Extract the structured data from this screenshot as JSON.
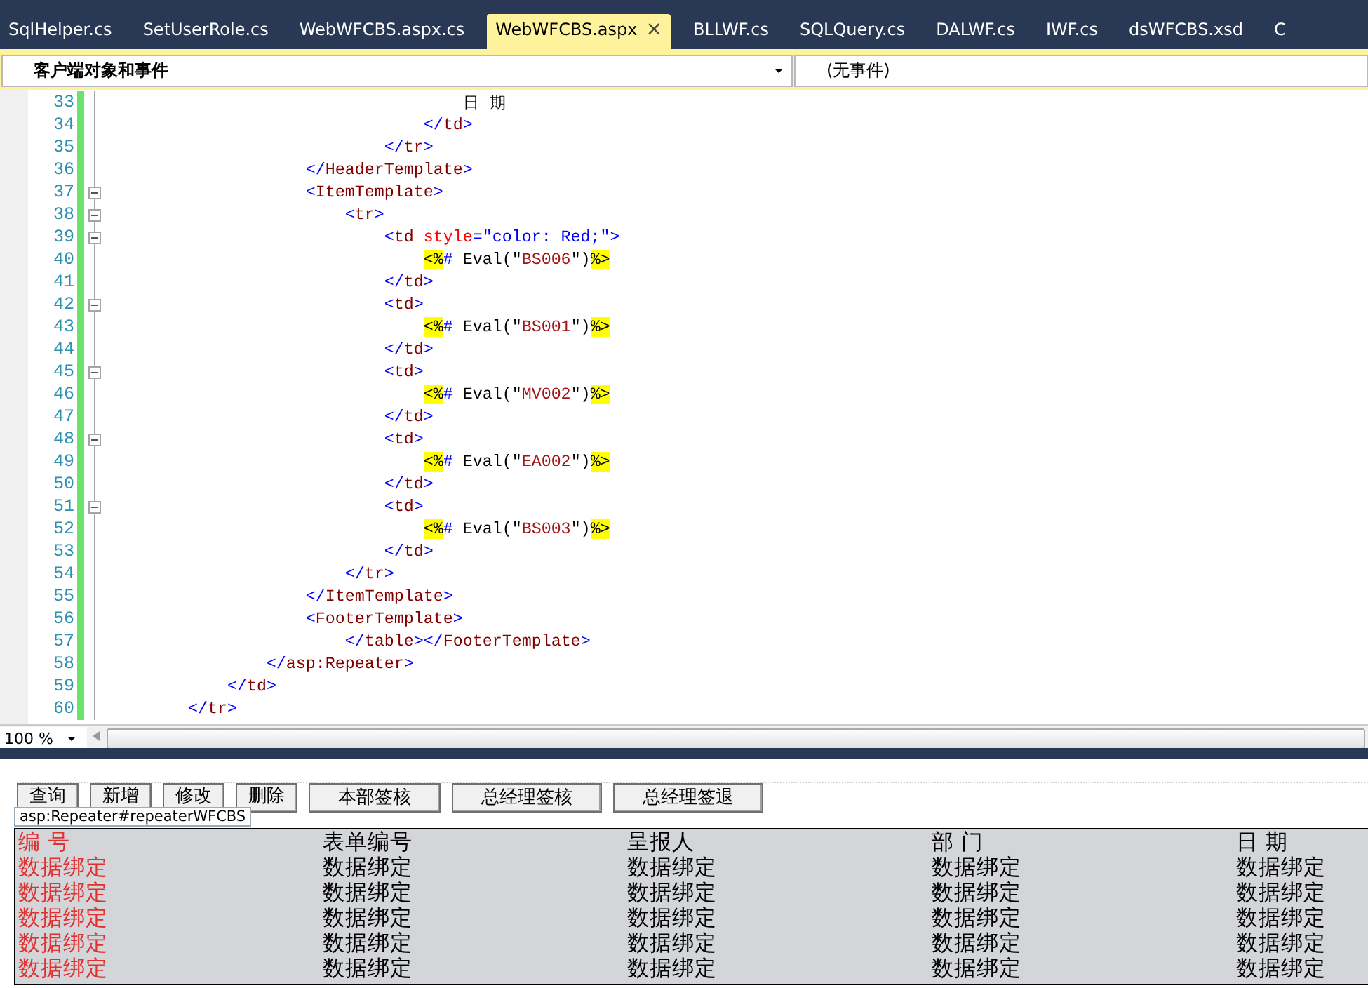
{
  "tabs": [
    {
      "label": "SqlHelper.cs",
      "selected": false
    },
    {
      "label": "SetUserRole.cs",
      "selected": false
    },
    {
      "label": "WebWFCBS.aspx.cs",
      "selected": false
    },
    {
      "label": "WebWFCBS.aspx",
      "selected": true,
      "close": "×"
    },
    {
      "label": "BLLWF.cs",
      "selected": false
    },
    {
      "label": "SQLQuery.cs",
      "selected": false
    },
    {
      "label": "DALWF.cs",
      "selected": false
    },
    {
      "label": "IWF.cs",
      "selected": false
    },
    {
      "label": "dsWFCBS.xsd",
      "selected": false
    },
    {
      "label": "C",
      "selected": false
    }
  ],
  "navigation_bar": {
    "objects": "客户端对象和事件",
    "events": "(无事件)"
  },
  "editor": {
    "lines": [
      {
        "number": "33",
        "collapsible": false,
        "tokens": [
          {
            "kind": "text",
            "text": "                                    日 期"
          }
        ]
      },
      {
        "number": "34",
        "collapsible": false,
        "tokens": [
          {
            "kind": "delimiter",
            "text": "                                </"
          },
          {
            "kind": "tag",
            "text": "td"
          },
          {
            "kind": "delimiter",
            "text": ">"
          }
        ]
      },
      {
        "number": "35",
        "collapsible": false,
        "tokens": [
          {
            "kind": "delimiter",
            "text": "                            </"
          },
          {
            "kind": "tag",
            "text": "tr"
          },
          {
            "kind": "delimiter",
            "text": ">"
          }
        ]
      },
      {
        "number": "36",
        "collapsible": false,
        "tokens": [
          {
            "kind": "delimiter",
            "text": "                    </"
          },
          {
            "kind": "tag",
            "text": "HeaderTemplate"
          },
          {
            "kind": "delimiter",
            "text": ">"
          }
        ]
      },
      {
        "number": "37",
        "collapsible": true,
        "tokens": [
          {
            "kind": "delimiter",
            "text": "                    <"
          },
          {
            "kind": "tag",
            "text": "ItemTemplate"
          },
          {
            "kind": "delimiter",
            "text": ">"
          }
        ]
      },
      {
        "number": "38",
        "collapsible": true,
        "tokens": [
          {
            "kind": "delimiter",
            "text": "                        <"
          },
          {
            "kind": "tag",
            "text": "tr"
          },
          {
            "kind": "delimiter",
            "text": ">"
          }
        ]
      },
      {
        "number": "39",
        "collapsible": true,
        "tokens": [
          {
            "kind": "delimiter",
            "text": "                            <"
          },
          {
            "kind": "tag",
            "text": "td"
          },
          {
            "kind": "attribute",
            "text": " style"
          },
          {
            "kind": "delimiter",
            "text": "=\""
          },
          {
            "kind": "value",
            "text": "color: Red;"
          },
          {
            "kind": "delimiter",
            "text": "\">"
          }
        ]
      },
      {
        "number": "40",
        "collapsible": false,
        "tokens": [
          {
            "kind": "server",
            "text": "                                <%"
          },
          {
            "kind": "hash",
            "text": "#"
          },
          {
            "kind": "text",
            "text": " Eval(\""
          },
          {
            "kind": "string",
            "text": "BS006"
          },
          {
            "kind": "text",
            "text": "\")"
          },
          {
            "kind": "server",
            "text": "%>"
          }
        ]
      },
      {
        "number": "41",
        "collapsible": false,
        "tokens": [
          {
            "kind": "delimiter",
            "text": "                            </"
          },
          {
            "kind": "tag",
            "text": "td"
          },
          {
            "kind": "delimiter",
            "text": ">"
          }
        ]
      },
      {
        "number": "42",
        "collapsible": true,
        "tokens": [
          {
            "kind": "delimiter",
            "text": "                            <"
          },
          {
            "kind": "tag",
            "text": "td"
          },
          {
            "kind": "delimiter",
            "text": ">"
          }
        ]
      },
      {
        "number": "43",
        "collapsible": false,
        "tokens": [
          {
            "kind": "server",
            "text": "                                <%"
          },
          {
            "kind": "hash",
            "text": "#"
          },
          {
            "kind": "text",
            "text": " Eval(\""
          },
          {
            "kind": "string",
            "text": "BS001"
          },
          {
            "kind": "text",
            "text": "\")"
          },
          {
            "kind": "server",
            "text": "%>"
          }
        ]
      },
      {
        "number": "44",
        "collapsible": false,
        "tokens": [
          {
            "kind": "delimiter",
            "text": "                            </"
          },
          {
            "kind": "tag",
            "text": "td"
          },
          {
            "kind": "delimiter",
            "text": ">"
          }
        ]
      },
      {
        "number": "45",
        "collapsible": true,
        "tokens": [
          {
            "kind": "delimiter",
            "text": "                            <"
          },
          {
            "kind": "tag",
            "text": "td"
          },
          {
            "kind": "delimiter",
            "text": ">"
          }
        ]
      },
      {
        "number": "46",
        "collapsible": false,
        "tokens": [
          {
            "kind": "server",
            "text": "                                <%"
          },
          {
            "kind": "hash",
            "text": "#"
          },
          {
            "kind": "text",
            "text": " Eval(\""
          },
          {
            "kind": "string",
            "text": "MV002"
          },
          {
            "kind": "text",
            "text": "\")"
          },
          {
            "kind": "server",
            "text": "%>"
          }
        ]
      },
      {
        "number": "47",
        "collapsible": false,
        "tokens": [
          {
            "kind": "delimiter",
            "text": "                            </"
          },
          {
            "kind": "tag",
            "text": "td"
          },
          {
            "kind": "delimiter",
            "text": ">"
          }
        ]
      },
      {
        "number": "48",
        "collapsible": true,
        "tokens": [
          {
            "kind": "delimiter",
            "text": "                            <"
          },
          {
            "kind": "tag",
            "text": "td"
          },
          {
            "kind": "delimiter",
            "text": ">"
          }
        ]
      },
      {
        "number": "49",
        "collapsible": false,
        "tokens": [
          {
            "kind": "server",
            "text": "                                <%"
          },
          {
            "kind": "hash",
            "text": "#"
          },
          {
            "kind": "text",
            "text": " Eval(\""
          },
          {
            "kind": "string",
            "text": "EA002"
          },
          {
            "kind": "text",
            "text": "\")"
          },
          {
            "kind": "server",
            "text": "%>"
          }
        ]
      },
      {
        "number": "50",
        "collapsible": false,
        "tokens": [
          {
            "kind": "delimiter",
            "text": "                            </"
          },
          {
            "kind": "tag",
            "text": "td"
          },
          {
            "kind": "delimiter",
            "text": ">"
          }
        ]
      },
      {
        "number": "51",
        "collapsible": true,
        "tokens": [
          {
            "kind": "delimiter",
            "text": "                            <"
          },
          {
            "kind": "tag",
            "text": "td"
          },
          {
            "kind": "delimiter",
            "text": ">"
          }
        ]
      },
      {
        "number": "52",
        "collapsible": false,
        "tokens": [
          {
            "kind": "server",
            "text": "                                <%"
          },
          {
            "kind": "hash",
            "text": "#"
          },
          {
            "kind": "text",
            "text": " Eval(\""
          },
          {
            "kind": "string",
            "text": "BS003"
          },
          {
            "kind": "text",
            "text": "\")"
          },
          {
            "kind": "server",
            "text": "%>"
          }
        ]
      },
      {
        "number": "53",
        "collapsible": false,
        "tokens": [
          {
            "kind": "delimiter",
            "text": "                            </"
          },
          {
            "kind": "tag",
            "text": "td"
          },
          {
            "kind": "delimiter",
            "text": ">"
          }
        ]
      },
      {
        "number": "54",
        "collapsible": false,
        "tokens": [
          {
            "kind": "delimiter",
            "text": "                        </"
          },
          {
            "kind": "tag",
            "text": "tr"
          },
          {
            "kind": "delimiter",
            "text": ">"
          }
        ]
      },
      {
        "number": "55",
        "collapsible": false,
        "tokens": [
          {
            "kind": "delimiter",
            "text": "                    </"
          },
          {
            "kind": "tag",
            "text": "ItemTemplate"
          },
          {
            "kind": "delimiter",
            "text": ">"
          }
        ]
      },
      {
        "number": "56",
        "collapsible": false,
        "tokens": [
          {
            "kind": "delimiter",
            "text": "                    <"
          },
          {
            "kind": "tag",
            "text": "FooterTemplate"
          },
          {
            "kind": "delimiter",
            "text": ">"
          }
        ]
      },
      {
        "number": "57",
        "collapsible": false,
        "tokens": [
          {
            "kind": "delimiter",
            "text": "                        </"
          },
          {
            "kind": "tag",
            "text": "table"
          },
          {
            "kind": "delimiter",
            "text": "></"
          },
          {
            "kind": "tag",
            "text": "FooterTemplate"
          },
          {
            "kind": "delimiter",
            "text": ">"
          }
        ]
      },
      {
        "number": "58",
        "collapsible": false,
        "tokens": [
          {
            "kind": "delimiter",
            "text": "                </"
          },
          {
            "kind": "tag",
            "text": "asp:Repeater"
          },
          {
            "kind": "delimiter",
            "text": ">"
          }
        ]
      },
      {
        "number": "59",
        "collapsible": false,
        "tokens": [
          {
            "kind": "delimiter",
            "text": "            </"
          },
          {
            "kind": "tag",
            "text": "td"
          },
          {
            "kind": "delimiter",
            "text": ">"
          }
        ]
      },
      {
        "number": "60",
        "collapsible": false,
        "tokens": [
          {
            "kind": "delimiter",
            "text": "        </"
          },
          {
            "kind": "tag",
            "text": "tr"
          },
          {
            "kind": "delimiter",
            "text": ">"
          }
        ]
      }
    ],
    "zoom": "100 %"
  },
  "design_view": {
    "buttons": [
      "查询",
      "新增",
      "修改",
      "删除",
      "本部签核",
      "总经理签核",
      "总经理签退"
    ],
    "tooltip": "asp:Repeater#repeaterWFCBS",
    "table": {
      "columns": [
        "编 号",
        "表单编号",
        "呈报人",
        "部 门",
        "日 期"
      ],
      "rows": [
        [
          "数据绑定",
          "数据绑定",
          "数据绑定",
          "数据绑定",
          "数据绑定"
        ],
        [
          "数据绑定",
          "数据绑定",
          "数据绑定",
          "数据绑定",
          "数据绑定"
        ],
        [
          "数据绑定",
          "数据绑定",
          "数据绑定",
          "数据绑定",
          "数据绑定"
        ],
        [
          "数据绑定",
          "数据绑定",
          "数据绑定",
          "数据绑定",
          "数据绑定"
        ],
        [
          "数据绑定",
          "数据绑定",
          "数据绑定",
          "数据绑定",
          "数据绑定"
        ]
      ]
    }
  }
}
